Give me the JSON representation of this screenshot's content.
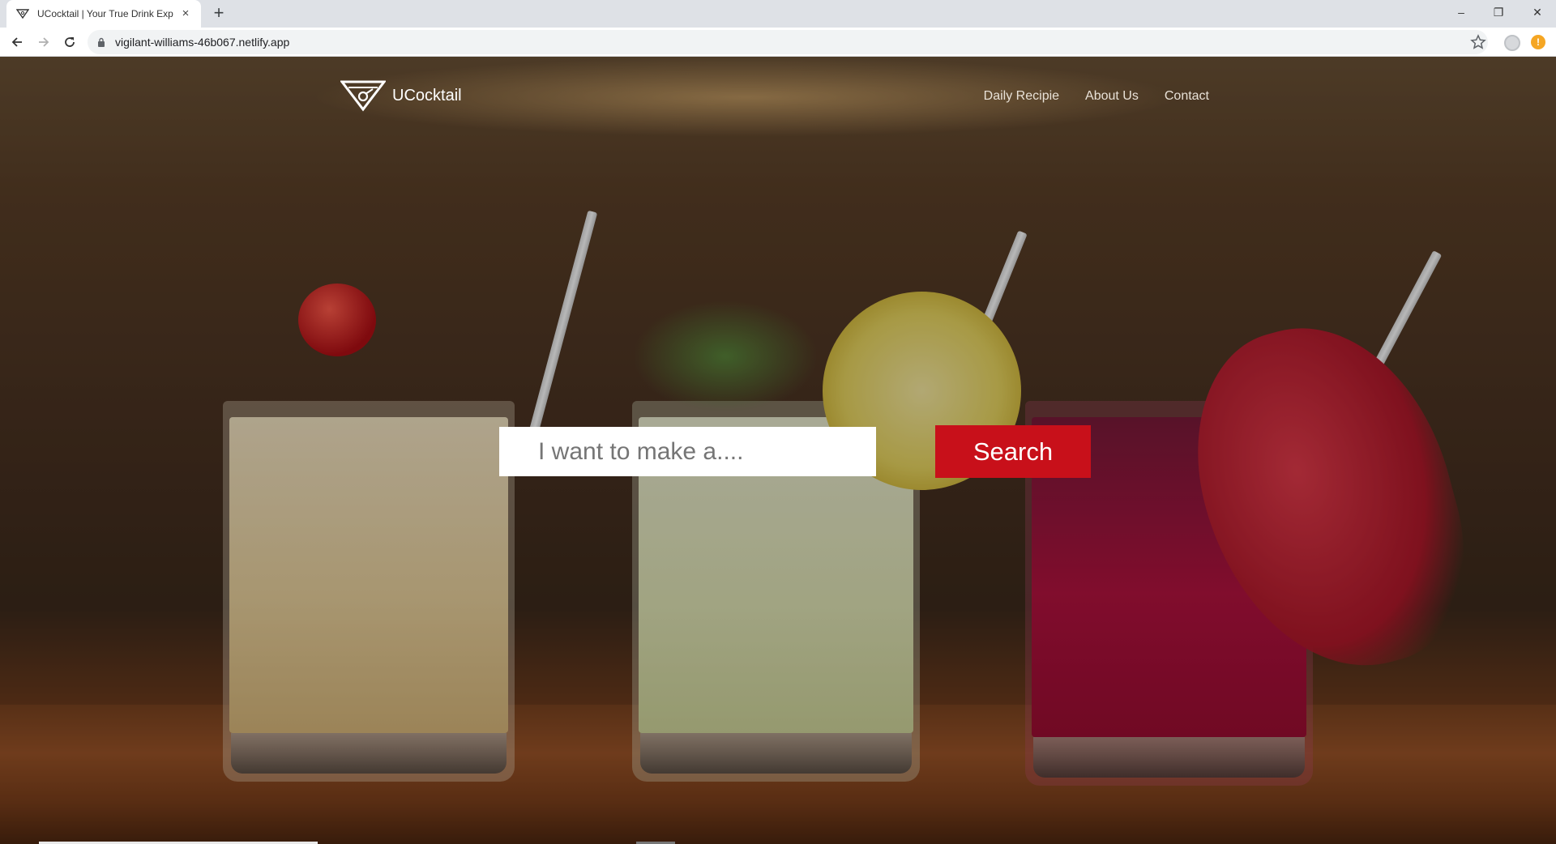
{
  "browser": {
    "tab_title": "UCocktail | Your True Drink Exper",
    "tab_close": "×",
    "new_tab": "+",
    "url": "vigilant-williams-46b067.netlify.app",
    "window_controls": {
      "minimize": "–",
      "restore": "❐",
      "close": "✕"
    }
  },
  "site": {
    "brand": "UCocktail",
    "nav": [
      "Daily Recipie",
      "About Us",
      "Contact"
    ],
    "search": {
      "placeholder": "I want to make a....",
      "value": "",
      "button_label": "Search"
    }
  },
  "colors": {
    "accent": "#c8101a",
    "nav_text": "#e9e2d8",
    "tab_bar": "#dee1e6"
  },
  "icons": [
    "cocktail-logo-icon",
    "back-arrow-icon",
    "forward-arrow-icon",
    "reload-icon",
    "lock-icon",
    "star-icon",
    "profile-icon",
    "update-alert-icon"
  ]
}
